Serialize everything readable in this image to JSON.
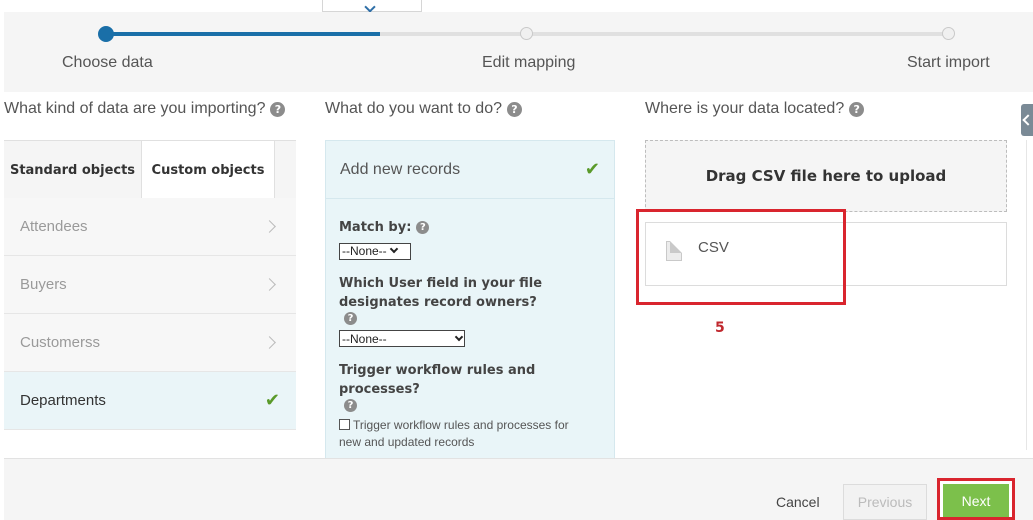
{
  "wizard": {
    "steps": [
      {
        "label": "Choose data",
        "state": "active"
      },
      {
        "label": "Edit mapping",
        "state": "pending"
      },
      {
        "label": "Start import",
        "state": "pending"
      }
    ]
  },
  "left": {
    "heading": "What kind of data are you importing?",
    "tabs": [
      "Standard objects",
      "Custom objects"
    ],
    "selected_tab": "Custom objects",
    "items": [
      {
        "label": "Attendees",
        "selected": false
      },
      {
        "label": "Buyers",
        "selected": false
      },
      {
        "label": "Customerss",
        "selected": false
      },
      {
        "label": "Departments",
        "selected": true
      }
    ]
  },
  "middle": {
    "heading": "What do you want to do?",
    "action": "Add new records",
    "match_by_label": "Match by:",
    "match_by_value": "--None--",
    "owner_label": "Which User field in your file designates record owners?",
    "owner_value": "--None--",
    "workflow_label": "Trigger workflow rules and processes?",
    "workflow_checkbox_label": "Trigger workflow rules and processes for new and updated records",
    "workflow_checked": false
  },
  "right": {
    "heading": "Where is your data located?",
    "drop_zone": "Drag CSV file here to upload",
    "source_option": "CSV",
    "annotation_number": "5"
  },
  "footer": {
    "cancel": "Cancel",
    "previous": "Previous",
    "next": "Next"
  },
  "colors": {
    "progress_active": "#1a6fa8",
    "check": "#5a9a2a",
    "next_button": "#7cc04b",
    "highlight": "#d9252e",
    "selected_bg": "#eaf5f8"
  },
  "icons": [
    "help-icon",
    "chevron-right-icon",
    "checkmark-icon",
    "file-icon",
    "collapse-icon"
  ]
}
